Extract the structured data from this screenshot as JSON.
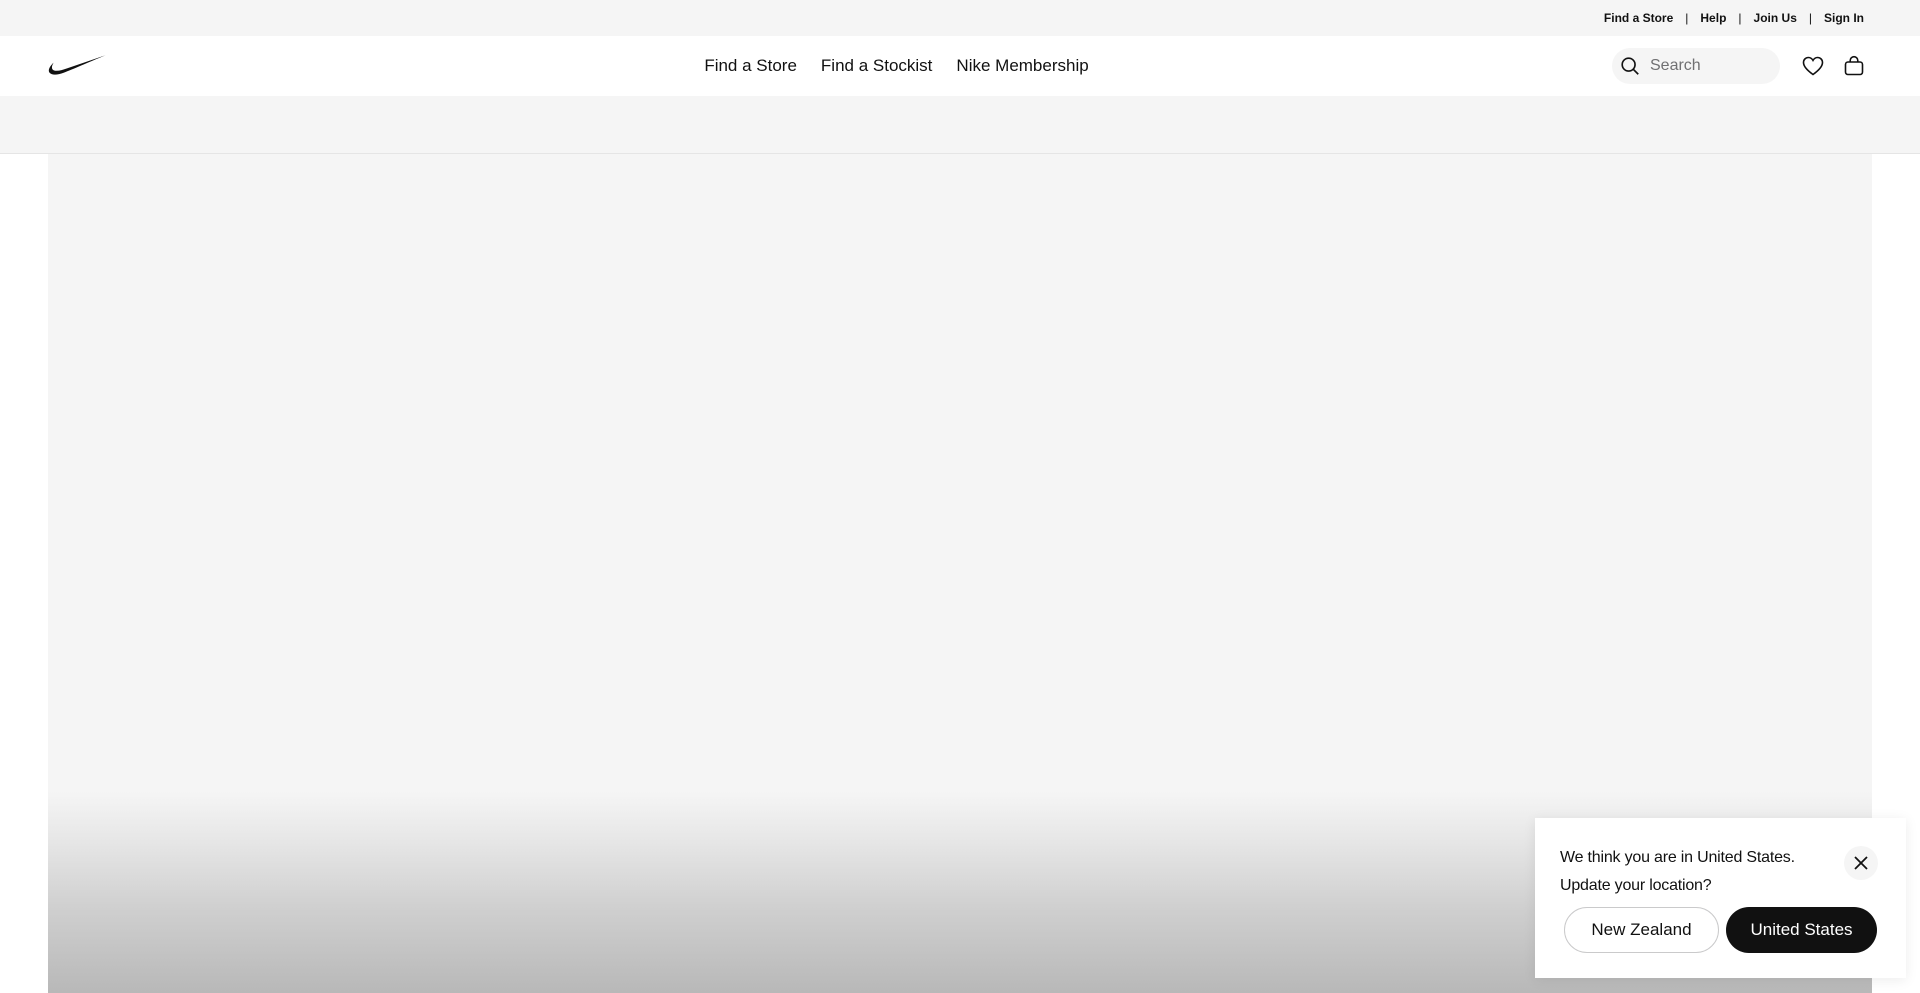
{
  "utility_bar": {
    "links": [
      "Find a Store",
      "Help",
      "Join Us",
      "Sign In"
    ],
    "separator": "|"
  },
  "header": {
    "logo_icon": "swoosh-icon",
    "nav": [
      "Find a Store",
      "Find a Stockist",
      "Nike Membership"
    ],
    "search": {
      "placeholder": "Search",
      "icon": "search-icon"
    },
    "favorites_icon": "heart-icon",
    "bag_icon": "bag-icon"
  },
  "location_modal": {
    "line1": "We think you are in United States.",
    "line2": "Update your location?",
    "close_icon": "close-icon",
    "secondary_button": "New Zealand",
    "primary_button": "United States"
  },
  "colors": {
    "brand_black": "#111111",
    "background_grey": "#f5f5f5",
    "muted_text": "#707072"
  }
}
